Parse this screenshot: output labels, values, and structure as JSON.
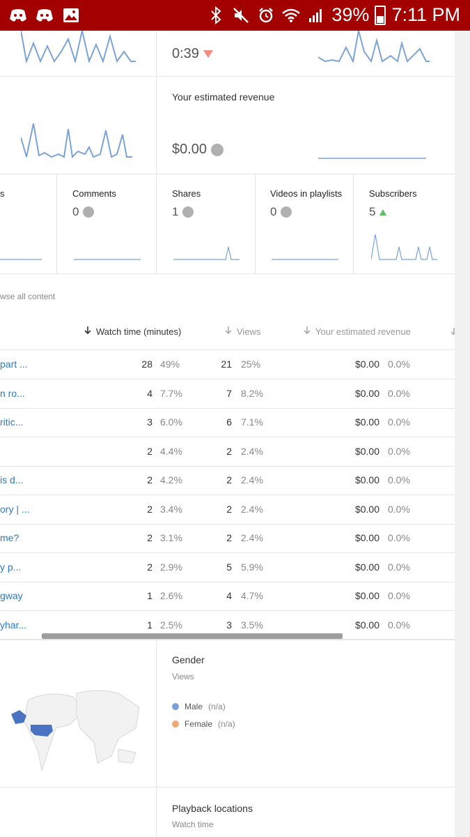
{
  "status_bar": {
    "battery_percent": "39%",
    "time": "7:11 PM"
  },
  "top_cards": {
    "avg_view_duration_value": "0:39",
    "revenue_title": "Your estimated revenue",
    "revenue_value": "$0.00"
  },
  "small_cards": [
    {
      "title": "s",
      "value": ""
    },
    {
      "title": "Comments",
      "value": "0"
    },
    {
      "title": "Shares",
      "value": "1"
    },
    {
      "title": "Videos in playlists",
      "value": "0"
    },
    {
      "title": "Subscribers",
      "value": "5"
    }
  ],
  "browse_link": "wse all content",
  "table": {
    "headers": {
      "watch_time": "Watch time (minutes)",
      "views": "Views",
      "revenue": "Your estimated revenue"
    },
    "rows": [
      {
        "title": "part ...",
        "watch": "28",
        "watch_pct": "49%",
        "views": "21",
        "views_pct": "25%",
        "rev": "$0.00",
        "rev_pct": "0.0%"
      },
      {
        "title": "n ro...",
        "watch": "4",
        "watch_pct": "7.7%",
        "views": "7",
        "views_pct": "8.2%",
        "rev": "$0.00",
        "rev_pct": "0.0%"
      },
      {
        "title": "ritic...",
        "watch": "3",
        "watch_pct": "6.0%",
        "views": "6",
        "views_pct": "7.1%",
        "rev": "$0.00",
        "rev_pct": "0.0%"
      },
      {
        "title": "",
        "watch": "2",
        "watch_pct": "4.4%",
        "views": "2",
        "views_pct": "2.4%",
        "rev": "$0.00",
        "rev_pct": "0.0%"
      },
      {
        "title": "is d...",
        "watch": "2",
        "watch_pct": "4.2%",
        "views": "2",
        "views_pct": "2.4%",
        "rev": "$0.00",
        "rev_pct": "0.0%"
      },
      {
        "title": "ory | ...",
        "watch": "2",
        "watch_pct": "3.4%",
        "views": "2",
        "views_pct": "2.4%",
        "rev": "$0.00",
        "rev_pct": "0.0%"
      },
      {
        "title": "me?",
        "watch": "2",
        "watch_pct": "3.1%",
        "views": "2",
        "views_pct": "2.4%",
        "rev": "$0.00",
        "rev_pct": "0.0%"
      },
      {
        "title": "y p...",
        "watch": "2",
        "watch_pct": "2.9%",
        "views": "5",
        "views_pct": "5.9%",
        "rev": "$0.00",
        "rev_pct": "0.0%"
      },
      {
        "title": "gway",
        "watch": "1",
        "watch_pct": "2.6%",
        "views": "4",
        "views_pct": "4.7%",
        "rev": "$0.00",
        "rev_pct": "0.0%"
      },
      {
        "title": "yhar...",
        "watch": "1",
        "watch_pct": "2.5%",
        "views": "3",
        "views_pct": "3.5%",
        "rev": "$0.00",
        "rev_pct": "0.0%"
      }
    ]
  },
  "gender": {
    "title": "Gender",
    "subtitle": "Views",
    "male_label": "Male",
    "male_value": "(n/a)",
    "female_label": "Female",
    "female_value": "(n/a)",
    "male_color": "#7b9fd4",
    "female_color": "#f0a878"
  },
  "playback": {
    "title": "Playback locations",
    "subtitle": "Watch time"
  },
  "colors": {
    "status_bar": "#a30000",
    "spark_line": "#7ba3d6",
    "link": "#2a79c3"
  }
}
